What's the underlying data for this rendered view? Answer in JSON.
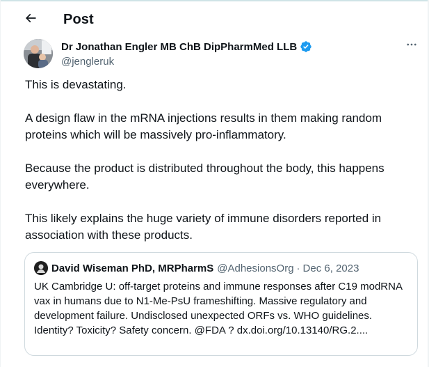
{
  "header": {
    "title": "Post",
    "back_icon": "arrow-left-icon"
  },
  "author": {
    "name": "Dr Jonathan Engler MB ChB DipPharmMed LLB",
    "handle": "@jengleruk",
    "verified_color": "#1d9bf0",
    "avatar_icon": "profile-photo"
  },
  "more_icon": "more-horizontal-icon",
  "tweet": {
    "paragraphs": [
      "This is devastating.",
      "A design flaw in the mRNA injections results in them making random proteins which will be massively pro-inflammatory.",
      "Because the product is distributed throughout the body, this happens everywhere.",
      "This likely explains the huge variety of immune disorders reported in association with these products."
    ]
  },
  "quote": {
    "name": "David Wiseman PhD, MRPharmS",
    "handle": "@AdhesionsOrg",
    "separator": "·",
    "date": "Dec 6, 2023",
    "text": "UK Cambridge U: off-target proteins and immune responses after C19 modRNA vax in humans due to N1-Me-PsU frameshifting. Massive regulatory and development failure. Undisclosed unexpected ORFs vs. WHO guidelines. Identity? Toxicity? Safety concern. @FDA ? dx.doi.org/10.13140/RG.2...."
  },
  "colors": {
    "text_primary": "#0f1419",
    "text_secondary": "#536471",
    "border": "#cfd9de",
    "accent": "#1d9bf0"
  }
}
